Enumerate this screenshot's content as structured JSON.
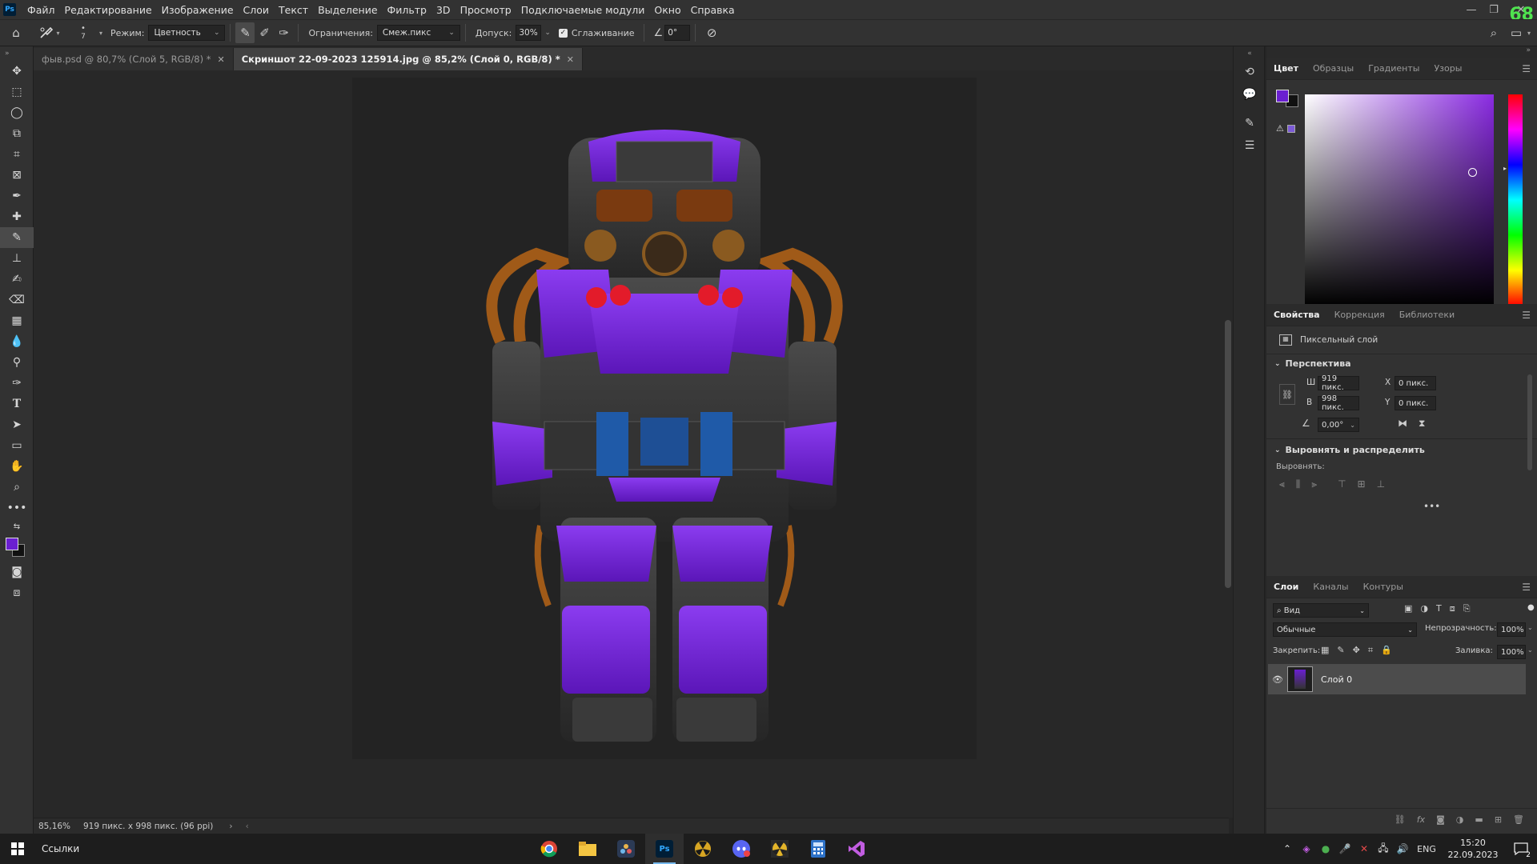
{
  "app": {
    "logo": "Ps",
    "badge": "68"
  },
  "menu": [
    "Файл",
    "Редактирование",
    "Изображение",
    "Слои",
    "Текст",
    "Выделение",
    "Фильтр",
    "3D",
    "Просмотр",
    "Подключаемые модули",
    "Окно",
    "Справка"
  ],
  "options": {
    "brush_size": "7",
    "mode_label": "Режим:",
    "mode_value": "Цветность",
    "limits_label": "Ограничения:",
    "limits_value": "Смеж.пикс",
    "tolerance_label": "Допуск:",
    "tolerance_value": "30%",
    "antialias_label": "Сглаживание",
    "antialias_checked": true,
    "angle_value": "0°"
  },
  "tabs": [
    {
      "label": "фыв.psd @ 80,7% (Слой 5, RGB/8) *",
      "active": false
    },
    {
      "label": "Скриншот 22-09-2023 125914.jpg @ 85,2% (Слой 0, RGB/8) *",
      "active": true
    }
  ],
  "status": {
    "zoom": "85,16%",
    "doc_info": "919 пикс. x 998 пикс. (96 ppi)"
  },
  "colors": {
    "foreground": "#6a1fd1",
    "background": "#111111",
    "accent": "#31a8ff"
  },
  "color_panel": {
    "tabs": [
      "Цвет",
      "Образцы",
      "Градиенты",
      "Узоры"
    ],
    "hue": "#8a2be2"
  },
  "properties": {
    "tabs": [
      "Свойства",
      "Коррекция",
      "Библиотеки"
    ],
    "layer_type": "Пиксельный слой",
    "section_transform": "Перспектива",
    "w_label": "Ш",
    "w_value": "919 пикс.",
    "h_label": "В",
    "h_value": "998 пикс.",
    "x_label": "X",
    "x_value": "0 пикс.",
    "y_label": "Y",
    "y_value": "0 пикс.",
    "angle_value": "0,00°",
    "section_align": "Выровнять и распределить",
    "align_label": "Выровнять:"
  },
  "layers": {
    "tabs": [
      "Слои",
      "Каналы",
      "Контуры"
    ],
    "filter_label": "Вид",
    "blend_mode": "Обычные",
    "opacity_label": "Непрозрачность:",
    "opacity_value": "100%",
    "lock_label": "Закрепить:",
    "fill_label": "Заливка:",
    "fill_value": "100%",
    "items": [
      {
        "name": "Слой 0",
        "visible": true
      }
    ]
  },
  "taskbar": {
    "search_label": "Ссылки",
    "lang": "ENG",
    "time": "15:20",
    "date": "22.09.2023",
    "notifications": "2"
  }
}
